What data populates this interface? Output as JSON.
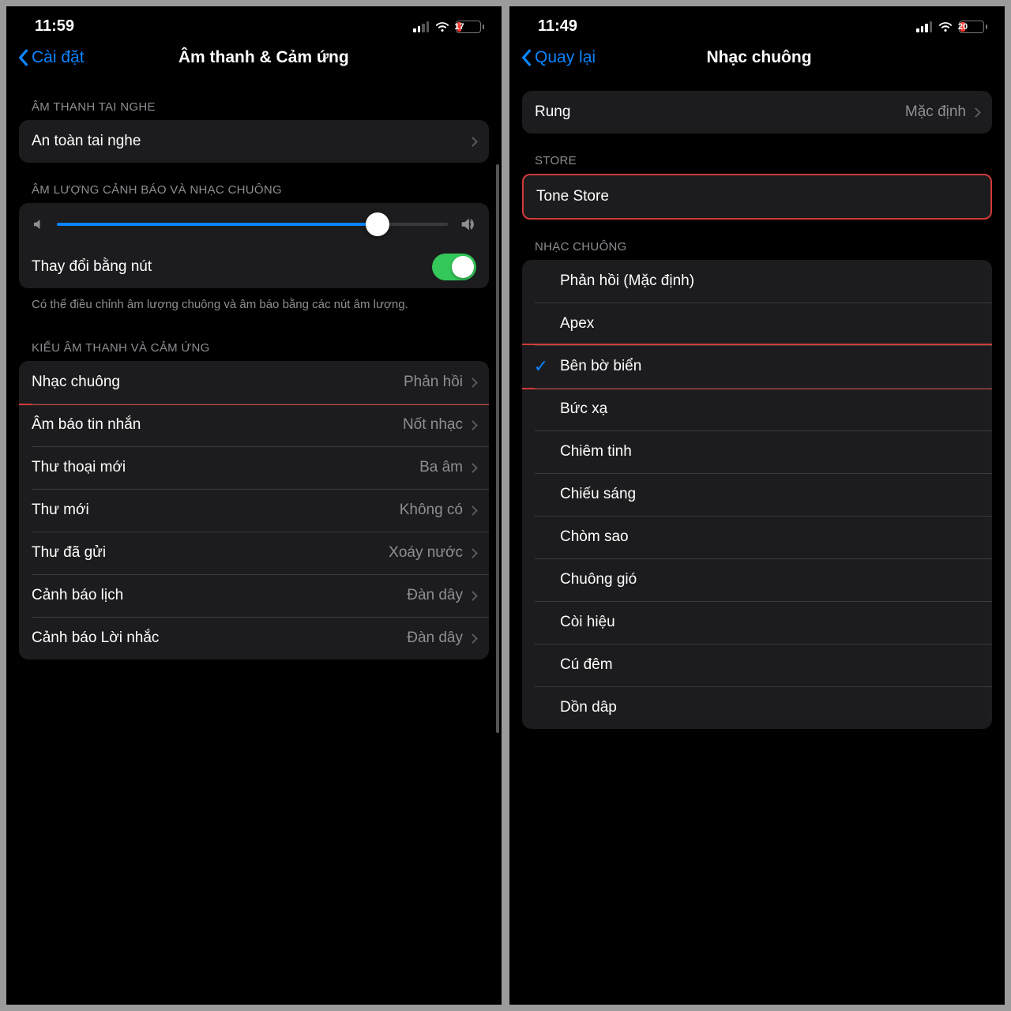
{
  "left": {
    "status": {
      "time": "11:59",
      "battery": "17",
      "cell_active": 2
    },
    "nav": {
      "back": "Cài đặt",
      "title": "Âm thanh & Cảm ứng"
    },
    "headphone_header": "ÂM THANH TAI NGHE",
    "headphone_safety": "An toàn tai nghe",
    "volume_header": "ÂM LƯỢNG CẢNH BÁO VÀ NHẠC CHUÔNG",
    "change_with_buttons": "Thay đổi bằng nút",
    "slider_pct": 82,
    "footer": "Có thể điều chỉnh âm lượng chuông và âm báo bằng các nút âm lượng.",
    "patterns_header": "KIỂU ÂM THANH VÀ CẢM ỨNG",
    "rows": [
      {
        "label": "Nhạc chuông",
        "value": "Phản hồi",
        "hl": true
      },
      {
        "label": "Âm báo tin nhắn",
        "value": "Nốt nhạc",
        "hl": false
      },
      {
        "label": "Thư thoại mới",
        "value": "Ba âm",
        "hl": false
      },
      {
        "label": "Thư mới",
        "value": "Không có",
        "hl": false
      },
      {
        "label": "Thư đã gửi",
        "value": "Xoáy nước",
        "hl": false
      },
      {
        "label": "Cảnh báo lịch",
        "value": "Đàn dây",
        "hl": false
      },
      {
        "label": "Cảnh báo Lời nhắc",
        "value": "Đàn dây",
        "hl": false
      }
    ]
  },
  "right": {
    "status": {
      "time": "11:49",
      "battery": "20",
      "cell_active": 3
    },
    "nav": {
      "back": "Quay lại",
      "title": "Nhạc chuông"
    },
    "vibration_label": "Rung",
    "vibration_value": "Mặc định",
    "store_header": "STORE",
    "tone_store": "Tone Store",
    "ringtone_header": "NHẠC CHUÔNG",
    "tones": [
      {
        "name": "Phản hồi (Mặc định)",
        "sel": false,
        "hl": false
      },
      {
        "name": "Apex",
        "sel": false,
        "hl": false
      },
      {
        "name": "Bên bờ biển",
        "sel": true,
        "hl": true
      },
      {
        "name": "Bức xạ",
        "sel": false,
        "hl": false
      },
      {
        "name": "Chiêm tinh",
        "sel": false,
        "hl": false
      },
      {
        "name": "Chiếu sáng",
        "sel": false,
        "hl": false
      },
      {
        "name": "Chòm sao",
        "sel": false,
        "hl": false
      },
      {
        "name": "Chuông gió",
        "sel": false,
        "hl": false
      },
      {
        "name": "Còi hiệu",
        "sel": false,
        "hl": false
      },
      {
        "name": "Cú đêm",
        "sel": false,
        "hl": false
      },
      {
        "name": "Dồn dâp",
        "sel": false,
        "hl": false
      }
    ]
  }
}
